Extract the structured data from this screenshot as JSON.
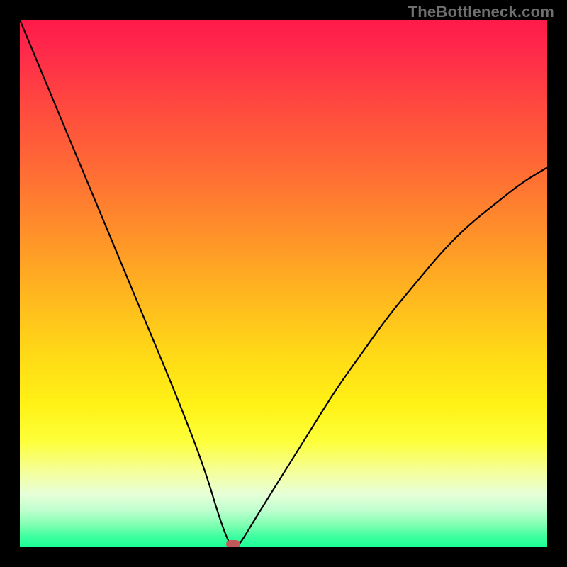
{
  "watermark": "TheBottleneck.com",
  "chart_data": {
    "type": "line",
    "title": "",
    "xlabel": "",
    "ylabel": "",
    "xlim": [
      0,
      100
    ],
    "ylim": [
      0,
      100
    ],
    "grid": false,
    "legend": false,
    "series": [
      {
        "name": "bottleneck-curve",
        "x": [
          0,
          5,
          10,
          15,
          20,
          25,
          30,
          35,
          38,
          40,
          41,
          42,
          45,
          50,
          55,
          60,
          65,
          70,
          75,
          80,
          85,
          90,
          95,
          100
        ],
        "values": [
          100,
          88,
          76,
          64,
          52,
          40,
          28,
          15,
          5,
          0,
          0,
          1,
          6,
          14,
          22,
          30,
          37,
          44,
          50,
          56,
          61,
          65,
          69,
          72
        ]
      }
    ],
    "annotations": [
      {
        "name": "optimal-marker",
        "x": 40.5,
        "y": 0
      }
    ],
    "background_gradient": {
      "top": "#ff1a4a",
      "middle": "#ffe015",
      "bottom": "#1aff97"
    }
  }
}
